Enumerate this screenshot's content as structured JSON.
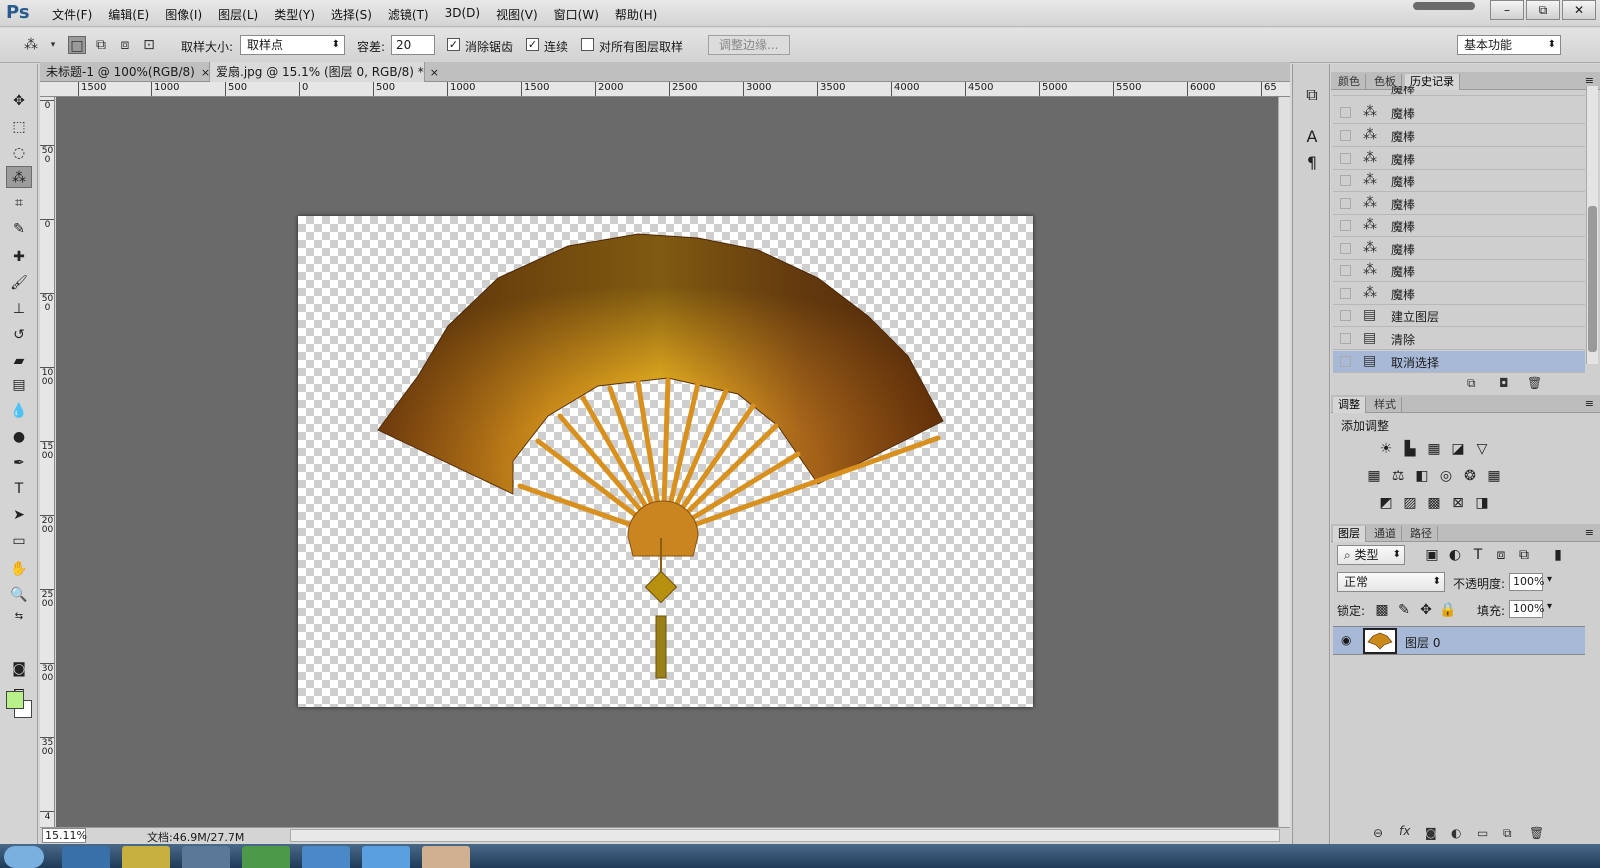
{
  "app": {
    "logo": "Ps"
  },
  "menu": [
    "文件(F)",
    "编辑(E)",
    "图像(I)",
    "图层(L)",
    "类型(Y)",
    "选择(S)",
    "滤镜(T)",
    "3D(D)",
    "视图(V)",
    "窗口(W)",
    "帮助(H)"
  ],
  "window_controls": {
    "minimize": "–",
    "restore": "⧉",
    "close": "✕"
  },
  "options": {
    "sample_size_label": "取样大小:",
    "sample_size_value": "取样点",
    "tolerance_label": "容差:",
    "tolerance_value": "20",
    "anti_alias_label": "消除锯齿",
    "contiguous_label": "连续",
    "sample_all_layers_label": "对所有图层取样",
    "refine_edge_label": "调整边缘...",
    "workspace_value": "基本功能",
    "anti_alias_checked": true,
    "contiguous_checked": true,
    "sample_all_checked": false
  },
  "tabs": [
    {
      "label": "未标题-1 @ 100%(RGB/8)",
      "close": "×",
      "active": false
    },
    {
      "label": "爱扇.jpg @ 15.1% (图层 0, RGB/8) *",
      "close": "×",
      "active": true
    }
  ],
  "ruler_top": [
    "1500",
    "1000",
    "500",
    "0",
    "500",
    "1000",
    "1500",
    "2000",
    "2500",
    "3000",
    "3500",
    "4000",
    "4500",
    "5000",
    "5500",
    "6000",
    "65"
  ],
  "ruler_left": [
    "0",
    "500",
    "0",
    "500",
    "1000",
    "1500",
    "2000",
    "2500",
    "3000",
    "3500",
    "4"
  ],
  "status": {
    "zoom": "15.11%",
    "doc_info": "文档:46.9M/27.7M"
  },
  "colors": {
    "foreground": "#b8f08a",
    "background": "#ffffff",
    "selection": "#a8b9d8",
    "canvas_bg": "#6a6a6a"
  },
  "history_panel": {
    "tabs": [
      "颜色",
      "色板",
      "历史记录"
    ],
    "active_tab": "历史记录",
    "partial_top": "魔棒",
    "items": [
      {
        "icon": "magic-wand-icon",
        "label": "魔棒",
        "selected": false
      },
      {
        "icon": "magic-wand-icon",
        "label": "魔棒",
        "selected": false
      },
      {
        "icon": "magic-wand-icon",
        "label": "魔棒",
        "selected": false
      },
      {
        "icon": "magic-wand-icon",
        "label": "魔棒",
        "selected": false
      },
      {
        "icon": "magic-wand-icon",
        "label": "魔棒",
        "selected": false
      },
      {
        "icon": "magic-wand-icon",
        "label": "魔棒",
        "selected": false
      },
      {
        "icon": "magic-wand-icon",
        "label": "魔棒",
        "selected": false
      },
      {
        "icon": "magic-wand-icon",
        "label": "魔棒",
        "selected": false
      },
      {
        "icon": "magic-wand-icon",
        "label": "魔棒",
        "selected": false
      },
      {
        "icon": "document-icon",
        "label": "建立图层",
        "selected": false
      },
      {
        "icon": "document-icon",
        "label": "清除",
        "selected": false
      },
      {
        "icon": "document-icon",
        "label": "取消选择",
        "selected": true
      }
    ]
  },
  "adjustments_panel": {
    "tabs": [
      "调整",
      "样式"
    ],
    "title": "添加调整"
  },
  "layers_panel": {
    "tabs": [
      "图层",
      "通道",
      "路径"
    ],
    "filter_kind": "类型",
    "blend_mode": "正常",
    "opacity_label": "不透明度:",
    "opacity_value": "100%",
    "lock_label": "锁定:",
    "fill_label": "填充:",
    "fill_value": "100%",
    "layers": [
      {
        "name": "图层 0",
        "visible": true,
        "selected": true
      }
    ]
  }
}
